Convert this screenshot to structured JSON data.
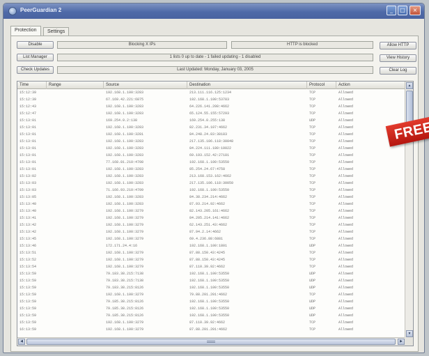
{
  "window": {
    "title": "PeerGuardian 2"
  },
  "tabs": [
    {
      "label": "Protection",
      "active": true
    },
    {
      "label": "Settings",
      "active": false
    }
  ],
  "left_buttons": {
    "disable": "Disable",
    "list_manager": "List Manager",
    "check_updates": "Check Updates"
  },
  "right_buttons": {
    "allow_http": "Allow HTTP",
    "view_history": "View History",
    "clear_log": "Clear Log"
  },
  "status": {
    "blocking": "Blocking X IPs",
    "http": "HTTP is blocked",
    "lists": "1 lists 0 up to date - 1 failed updating - 1 disabled",
    "last_updated": "Last Updated: Monday, January 03, 2005"
  },
  "log": {
    "columns": {
      "time": "Time",
      "range": "Range",
      "source": "Source",
      "destination": "Destination",
      "protocol": "Protocol",
      "action": "Action"
    },
    "rows": [
      {
        "time": "15:12:39",
        "range": "",
        "source": "192.168.1.100:3283",
        "destination": "213.111.116.125:1234",
        "protocol": "TCP",
        "action": "Allowed"
      },
      {
        "time": "15:12:39",
        "range": "",
        "source": "67.169.42.221:6875",
        "destination": "192.168.1.100:53783",
        "protocol": "TCP",
        "action": "Allowed"
      },
      {
        "time": "15:12:43",
        "range": "",
        "source": "192.168.1.100:3283",
        "destination": "64.226.141.208:4662",
        "protocol": "TCP",
        "action": "Allowed"
      },
      {
        "time": "15:12:47",
        "range": "",
        "source": "192.168.1.100:3283",
        "destination": "65.124.55.155:57293",
        "protocol": "TCP",
        "action": "Allowed"
      },
      {
        "time": "15:13:01",
        "range": "",
        "source": "169.254.0.2:138",
        "destination": "169.254.0.255:138",
        "protocol": "UDP",
        "action": "Allowed"
      },
      {
        "time": "15:13:01",
        "range": "",
        "source": "192.168.1.100:3283",
        "destination": "82.231.34.107:4662",
        "protocol": "TCP",
        "action": "Allowed"
      },
      {
        "time": "15:13:01",
        "range": "",
        "source": "192.168.1.100:3281",
        "destination": "84.248.24.83:38183",
        "protocol": "TCP",
        "action": "Allowed"
      },
      {
        "time": "15:13:01",
        "range": "",
        "source": "192.168.1.100:3283",
        "destination": "217.135.106.118:30048",
        "protocol": "TCP",
        "action": "Allowed"
      },
      {
        "time": "15:13:01",
        "range": "",
        "source": "192.168.1.100:3283",
        "destination": "84.224.111.180:10022",
        "protocol": "TCP",
        "action": "Allowed"
      },
      {
        "time": "15:13:01",
        "range": "",
        "source": "192.168.1.100:3283",
        "destination": "69.193.152.42:27181",
        "protocol": "TCP",
        "action": "Allowed"
      },
      {
        "time": "15:13:01",
        "range": "",
        "source": "77.168.81.210:4708",
        "destination": "192.168.1.100:53550",
        "protocol": "TCP",
        "action": "Allowed"
      },
      {
        "time": "15:13:01",
        "range": "",
        "source": "192.168.1.100:3283",
        "destination": "85.254.24.67:4758",
        "protocol": "TCP",
        "action": "Allowed"
      },
      {
        "time": "15:13:02",
        "range": "",
        "source": "192.168.1.100:3283",
        "destination": "213.168.153.162:4662",
        "protocol": "TCP",
        "action": "Allowed"
      },
      {
        "time": "15:13:03",
        "range": "",
        "source": "192.168.1.100:3283",
        "destination": "217.135.106.118:30050",
        "protocol": "TCP",
        "action": "Allowed"
      },
      {
        "time": "15:13:03",
        "range": "",
        "source": "71.166.93.210:4709",
        "destination": "192.168.1.100:53550",
        "protocol": "TCP",
        "action": "Allowed"
      },
      {
        "time": "15:13:05",
        "range": "",
        "source": "192.168.1.100:3283",
        "destination": "84.38.234.214:4662",
        "protocol": "TCP",
        "action": "Allowed"
      },
      {
        "time": "15:13:40",
        "range": "",
        "source": "192.168.1.100:3283",
        "destination": "87.93.214.92:4662",
        "protocol": "TCP",
        "action": "Allowed"
      },
      {
        "time": "15:13:40",
        "range": "",
        "source": "192.168.1.100:3279",
        "destination": "82.143.205.161:4662",
        "protocol": "TCP",
        "action": "Allowed"
      },
      {
        "time": "15:13:41",
        "range": "",
        "source": "192.168.1.100:3279",
        "destination": "84.205.214.141:4662",
        "protocol": "TCP",
        "action": "Allowed"
      },
      {
        "time": "15:13:42",
        "range": "",
        "source": "192.168.1.100:3279",
        "destination": "62.143.251.43:4662",
        "protocol": "TCP",
        "action": "Allowed"
      },
      {
        "time": "15:13:42",
        "range": "",
        "source": "192.168.1.100:3279",
        "destination": "87.94.2.14:4662",
        "protocol": "TCP",
        "action": "Allowed"
      },
      {
        "time": "15:13:45",
        "range": "",
        "source": "192.168.1.100:3279",
        "destination": "69.4.236.88:6881",
        "protocol": "TCP",
        "action": "Allowed"
      },
      {
        "time": "15:13:46",
        "range": "",
        "source": "172.171.24.4:16",
        "destination": "192.168.1.100:1801",
        "protocol": "UDP",
        "action": "Allowed"
      },
      {
        "time": "15:13:51",
        "range": "",
        "source": "192.168.1.100:3279",
        "destination": "87.88.150.43:4245",
        "protocol": "TCP",
        "action": "Allowed"
      },
      {
        "time": "15:13:52",
        "range": "",
        "source": "192.168.1.100:3279",
        "destination": "87.88.150.43:4245",
        "protocol": "TCP",
        "action": "Allowed"
      },
      {
        "time": "15:13:54",
        "range": "",
        "source": "192.168.1.100:3279",
        "destination": "87.110.39.92:4662",
        "protocol": "TCP",
        "action": "Allowed"
      },
      {
        "time": "15:13:59",
        "range": "",
        "source": "79.183.38.215:7138",
        "destination": "192.168.1.100:53550",
        "protocol": "UDP",
        "action": "Allowed"
      },
      {
        "time": "15:13:59",
        "range": "",
        "source": "79.183.38.215:7138",
        "destination": "192.168.1.100:53550",
        "protocol": "UDP",
        "action": "Allowed"
      },
      {
        "time": "15:13:59",
        "range": "",
        "source": "79.183.38.215:8126",
        "destination": "192.168.1.100:53550",
        "protocol": "UDP",
        "action": "Allowed"
      },
      {
        "time": "15:13:59",
        "range": "",
        "source": "192.168.1.100:3279",
        "destination": "79.88.201.201:4662",
        "protocol": "TCP",
        "action": "Allowed"
      },
      {
        "time": "15:13:59",
        "range": "",
        "source": "79.185.38.215:8126",
        "destination": "192.168.1.100:53550",
        "protocol": "UDP",
        "action": "Allowed"
      },
      {
        "time": "15:13:59",
        "range": "",
        "source": "79.185.38.215:8126",
        "destination": "192.168.1.100:53550",
        "protocol": "UDP",
        "action": "Allowed"
      },
      {
        "time": "15:13:59",
        "range": "",
        "source": "79.185.38.215:8126",
        "destination": "192.168.1.100:53550",
        "protocol": "UDP",
        "action": "Allowed"
      },
      {
        "time": "15:13:59",
        "range": "",
        "source": "192.168.1.100:3279",
        "destination": "87.110.39.92:4662",
        "protocol": "TCP",
        "action": "Allowed"
      },
      {
        "time": "16:13:59",
        "range": "",
        "source": "192.168.1.100:3279",
        "destination": "87.88.201.201:4662",
        "protocol": "TCP",
        "action": "Allowed"
      }
    ]
  },
  "banner": {
    "text": "FREE"
  },
  "colors": {
    "titlebar": "#4f6aa8",
    "banner": "#d0261c"
  },
  "icons": [
    "app-icon",
    "minimize-icon",
    "maximize-icon",
    "close-icon",
    "scroll-up-icon",
    "scroll-down-icon",
    "scroll-left-icon",
    "scroll-right-icon"
  ]
}
